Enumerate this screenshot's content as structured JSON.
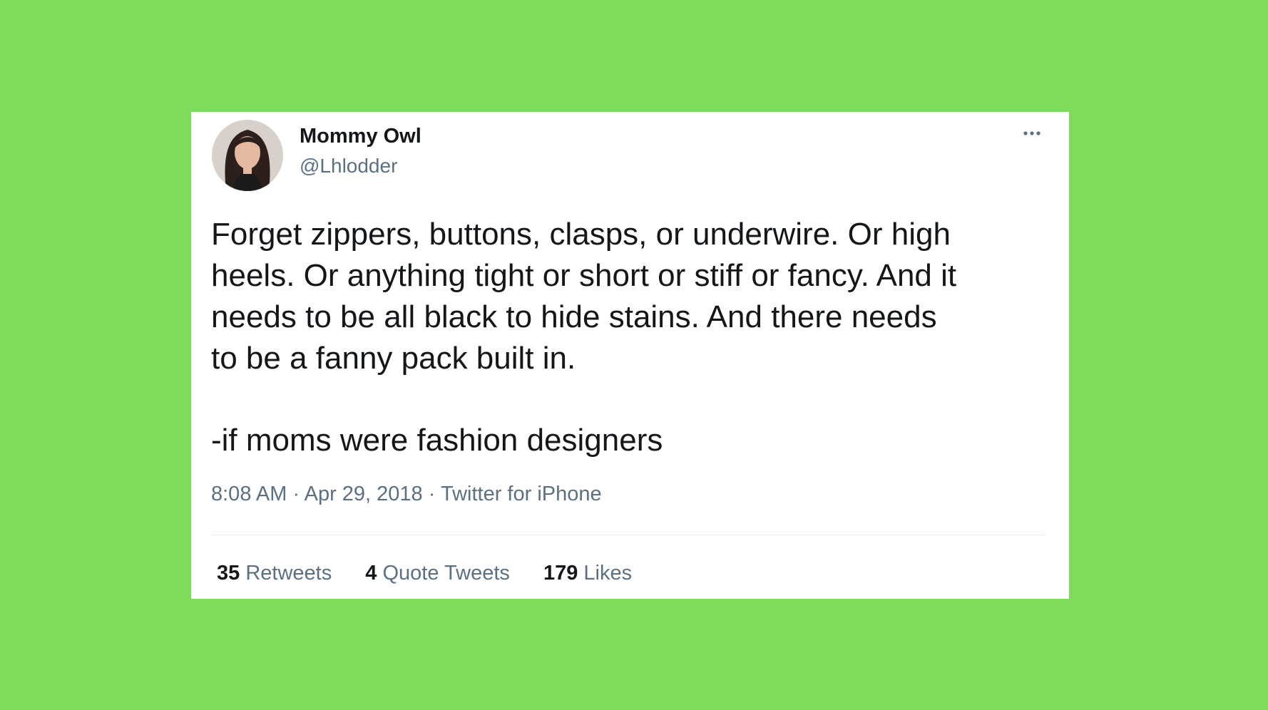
{
  "tweet": {
    "author_name": "Mommy Owl",
    "author_handle": "@Lhlodder",
    "more_icon": "more-horizontal-icon",
    "text_lines": [
      "Forget zippers, buttons, clasps, or underwire. Or high",
      "heels. Or anything tight or short or stiff or fancy. And it",
      "needs to be all black to hide stains. And there needs",
      "to be a fanny pack built in.",
      "-if moms were fashion designers"
    ],
    "time": "8:08 AM",
    "separator": "·",
    "date": "Apr 29, 2018",
    "source": "Twitter for iPhone",
    "stats": {
      "retweets_count": "35",
      "retweets_label": "Retweets",
      "quotes_count": "4",
      "quotes_label": "Quote Tweets",
      "likes_count": "179",
      "likes_label": "Likes"
    }
  },
  "colors": {
    "background": "#7fdb5c",
    "card": "#ffffff",
    "text": "#14171a",
    "secondary_text": "#5b7083",
    "divider": "#e1e8ed"
  }
}
